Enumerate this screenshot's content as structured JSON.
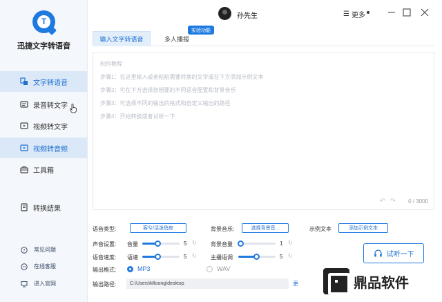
{
  "brand": {
    "name": "迅捷文字转语音",
    "logo_letter": "T"
  },
  "sidebar": {
    "items": [
      {
        "label": "文字转语音",
        "icon": "text-to-speech-icon",
        "active": true
      },
      {
        "label": "录音转文字",
        "icon": "recording-icon",
        "active": false
      },
      {
        "label": "视频转文字",
        "icon": "video-icon",
        "active": false
      },
      {
        "label": "视频转音频",
        "icon": "video-audio-icon",
        "active": true
      },
      {
        "label": "工具箱",
        "icon": "toolbox-icon",
        "active": false
      },
      {
        "label": "转换结果",
        "icon": "result-icon",
        "active": false
      }
    ],
    "footer": [
      {
        "label": "常见问题",
        "icon": "question-icon"
      },
      {
        "label": "在线客服",
        "icon": "chat-icon"
      },
      {
        "label": "进入官网",
        "icon": "monitor-icon"
      }
    ]
  },
  "topbar": {
    "user_name": "孙先生",
    "more_label": "更多"
  },
  "tabs": [
    {
      "label": "输入文字转语音"
    },
    {
      "label": "多人播报"
    }
  ],
  "tag_label": "实验功能",
  "editor": {
    "lines": [
      "制作教程",
      "步骤1：在这里输入或者粘贴需要转换的文字或在下方添加示例文本",
      "步骤2：可在下方选择您想要的不同语音配置和背景音乐",
      "步骤3：可选择不同的输出的格式和自定义输出的路径",
      "步骤4：开始转换或者试听一下"
    ],
    "counter": "0 / 3000"
  },
  "settings": {
    "voice_type_label": "语音类型:",
    "voice_type_value": "客兮/活泼俏皮",
    "bg_music_label": "背景音乐:",
    "bg_music_button": "选择背景音...",
    "sample_text_label": "示例文本",
    "sample_text_button": "添加示例文本",
    "sound_label": "声音设置:",
    "volume_label": "音量",
    "volume_value": "5",
    "bg_volume_label": "背景音量",
    "bg_volume_value": "1",
    "speed_label": "语音速度:",
    "rate_label": "语速",
    "rate_value": "5",
    "pitch_label": "主播语调",
    "pitch_value": "5",
    "format_label": "输出格式:",
    "format_mp3": "MP3",
    "format_wav": "WAV",
    "path_label": "输出路径:",
    "path_value": "C:\\Users\\Mloong\\desktop",
    "change_label": "更"
  },
  "try_button": "试听一下",
  "watermark": "鼎品软件",
  "colors": {
    "accent": "#1f7ae0",
    "active_bg": "#dbe8f8",
    "sidebar_bg": "#f4f7fb"
  }
}
